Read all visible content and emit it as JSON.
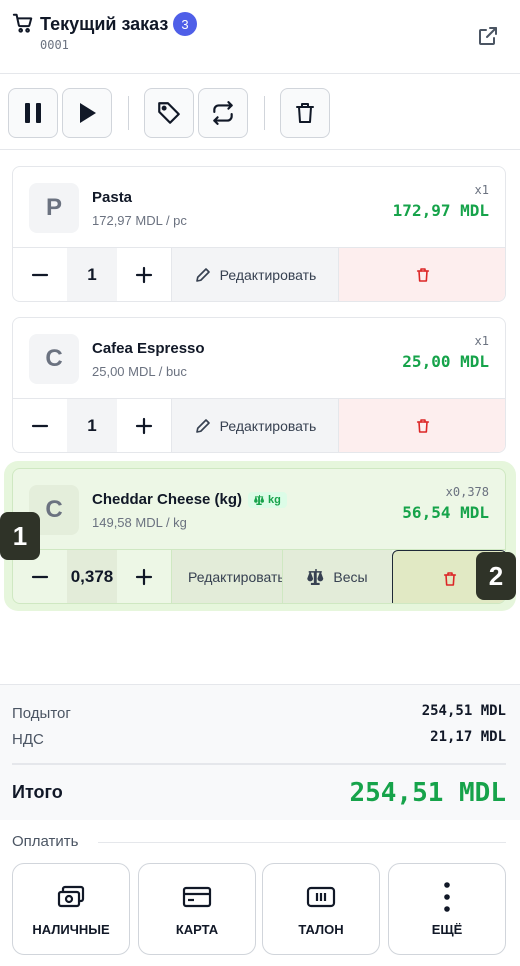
{
  "header": {
    "title": "Текущий заказ",
    "badge_count": "3",
    "order_number": "0001"
  },
  "items": [
    {
      "letter": "P",
      "name": "Pasta",
      "unit_price": "172,97 MDL / pc",
      "qty_tag": "x1",
      "line_total": "172,97 MDL",
      "qty": "1",
      "edit_label": "Редактировать"
    },
    {
      "letter": "C",
      "name": "Cafea Espresso",
      "unit_price": "25,00 MDL / buc",
      "qty_tag": "x1",
      "line_total": "25,00 MDL",
      "qty": "1",
      "edit_label": "Редактировать"
    },
    {
      "letter": "C",
      "name": "Cheddar Cheese (kg)",
      "weight_tag": "kg",
      "unit_price": "149,58 MDL / kg",
      "qty_tag": "x0,378",
      "line_total": "56,54 MDL",
      "qty": "0,378",
      "edit_label": "Редактировать",
      "scale_label": "Весы"
    }
  ],
  "markers": [
    "1",
    "2"
  ],
  "totals": {
    "subtotal_label": "Подытог",
    "subtotal_value": "254,51 MDL",
    "vat_label": "НДС",
    "vat_value": "21,17 MDL",
    "grand_label": "Итого",
    "grand_value": "254,51 MDL"
  },
  "pay": {
    "label": "Оплатить",
    "buttons": [
      {
        "label": "НАЛИЧНЫЕ",
        "icon": "cash-icon"
      },
      {
        "label": "КАРТА",
        "icon": "card-icon"
      },
      {
        "label": "ТАЛОН",
        "icon": "voucher-icon"
      },
      {
        "label": "ЕЩЁ",
        "icon": "more-icon"
      }
    ]
  },
  "colors": {
    "accent_green": "#16a34a",
    "badge_blue": "#4f5fe8",
    "delete_red": "#dc2626"
  }
}
